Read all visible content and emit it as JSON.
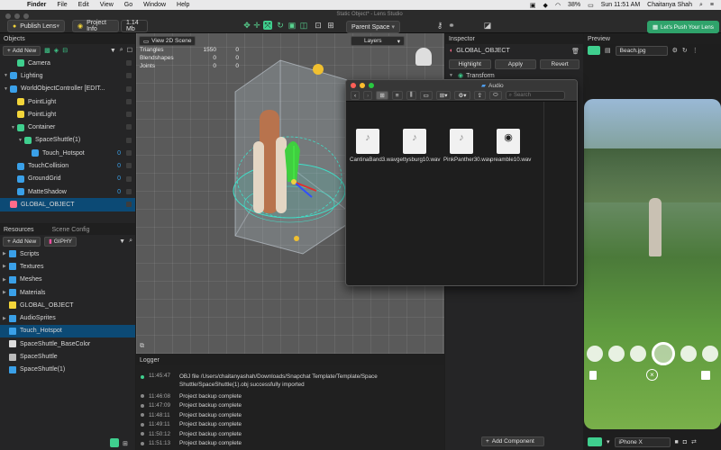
{
  "menubar": {
    "app": "Finder",
    "menus": [
      "File",
      "Edit",
      "View",
      "Go",
      "Window",
      "Help"
    ],
    "battery": "38%",
    "clock": "Sun 11:51 AM",
    "user": "Chaitanya Shah"
  },
  "toolbar": {
    "window_title": "Static Object* - Lens Studio",
    "publish": "Publish Lens",
    "project_info": "Project Info",
    "size": "1.14 Mb",
    "space": "Parent Space",
    "push": "Let's Push Your Lens"
  },
  "objects": {
    "header": "Objects",
    "add_new": "Add New",
    "items": [
      {
        "label": "Camera",
        "indent": 1
      },
      {
        "label": "Lighting",
        "indent": 0
      },
      {
        "label": "WorldObjectController [EDIT...",
        "indent": 0
      },
      {
        "label": "PointLight",
        "indent": 1
      },
      {
        "label": "PointLight",
        "indent": 1
      },
      {
        "label": "Container",
        "indent": 1
      },
      {
        "label": "SpaceShuttle(1)",
        "indent": 2
      },
      {
        "label": "Touch_Hotspot",
        "indent": 3
      },
      {
        "label": "TouchCollision",
        "indent": 1
      },
      {
        "label": "GroundGrid",
        "indent": 1
      },
      {
        "label": "MatteShadow",
        "indent": 1
      },
      {
        "label": "GLOBAL_OBJECT",
        "indent": 0
      }
    ],
    "selected": "GLOBAL_OBJECT",
    "counters": [
      "0",
      "0",
      "0",
      "0",
      "0"
    ]
  },
  "resources": {
    "tabs": [
      "Resources",
      "Scene Config"
    ],
    "add_new": "Add New",
    "giphy": "GIPHY",
    "items": [
      "Scripts",
      "Textures",
      "Meshes",
      "Materials",
      "GLOBAL_OBJECT",
      "AudioSprites",
      "Touch_Hotspot",
      "SpaceShuttle_BaseColor",
      "SpaceShuttle",
      "SpaceShuttle(1)"
    ],
    "selected": "Touch_Hotspot"
  },
  "scene": {
    "view_2d": "View 2D Scene",
    "layers": "Layers",
    "stats": [
      {
        "label": "Triangles",
        "a": "1550",
        "b": "0"
      },
      {
        "label": "Blendshapes",
        "a": "0",
        "b": "0"
      },
      {
        "label": "Joints",
        "a": "0",
        "b": "0"
      }
    ]
  },
  "logger": {
    "title": "Logger",
    "entries": [
      {
        "time": "11:45:47",
        "text": "OBJ file /Users/chaitanyashah/Downloads/Snapchat Template/Template/Space Shuttle/SpaceShuttle(1).obj successfully imported",
        "color": "#3fcf8e"
      },
      {
        "time": "11:46:08",
        "text": "Project backup complete",
        "color": "#888888"
      },
      {
        "time": "11:47:09",
        "text": "Project backup complete",
        "color": "#888888"
      },
      {
        "time": "11:48:11",
        "text": "Project backup complete",
        "color": "#888888"
      },
      {
        "time": "11:49:11",
        "text": "Project backup complete",
        "color": "#888888"
      },
      {
        "time": "11:50:12",
        "text": "Project backup complete",
        "color": "#888888"
      },
      {
        "time": "11:51:13",
        "text": "Project backup complete",
        "color": "#888888"
      }
    ]
  },
  "inspector": {
    "title": "Inspector",
    "object": "GLOBAL_OBJECT",
    "highlight": "Highlight",
    "apply": "Apply",
    "revert": "Revert",
    "transform": "Transform",
    "add_component": "Add Component"
  },
  "preview": {
    "title": "Preview",
    "image": "Beach.jpg",
    "device": "iPhone X"
  },
  "finder": {
    "title": "Audio",
    "search_placeholder": "Search",
    "files": [
      "CantinaBand3.wav",
      "gettysburg10.wav",
      "PinkPanther30.wav",
      "preamble10.wav"
    ]
  },
  "colors": {
    "accent_green": "#3fcf8e",
    "selection_blue": "#0c4a75",
    "push_bg": "#2fa36b"
  }
}
